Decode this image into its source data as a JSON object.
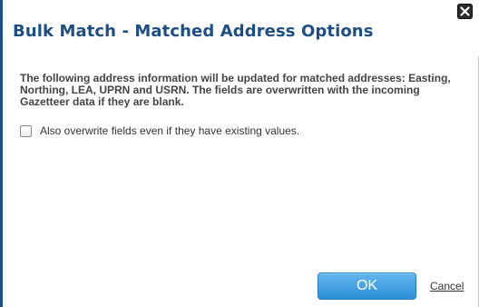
{
  "dialog": {
    "title": "Bulk Match - Matched Address Options",
    "description": "The following address information will be updated for matched addresses: Easting, Northing, LEA, UPRN and USRN. The fields are overwritten with the incoming Gazetteer data if they are blank.",
    "overwrite_option_label": "Also overwrite fields even if they have existing values.",
    "overwrite_option_checked": false,
    "ok_label": "OK",
    "cancel_label": "Cancel"
  },
  "colors": {
    "title": "#1d4f86",
    "ok_button": "#2b8fd6",
    "left_border": "#1a4f8a"
  },
  "icons": {
    "close": "close-icon"
  }
}
